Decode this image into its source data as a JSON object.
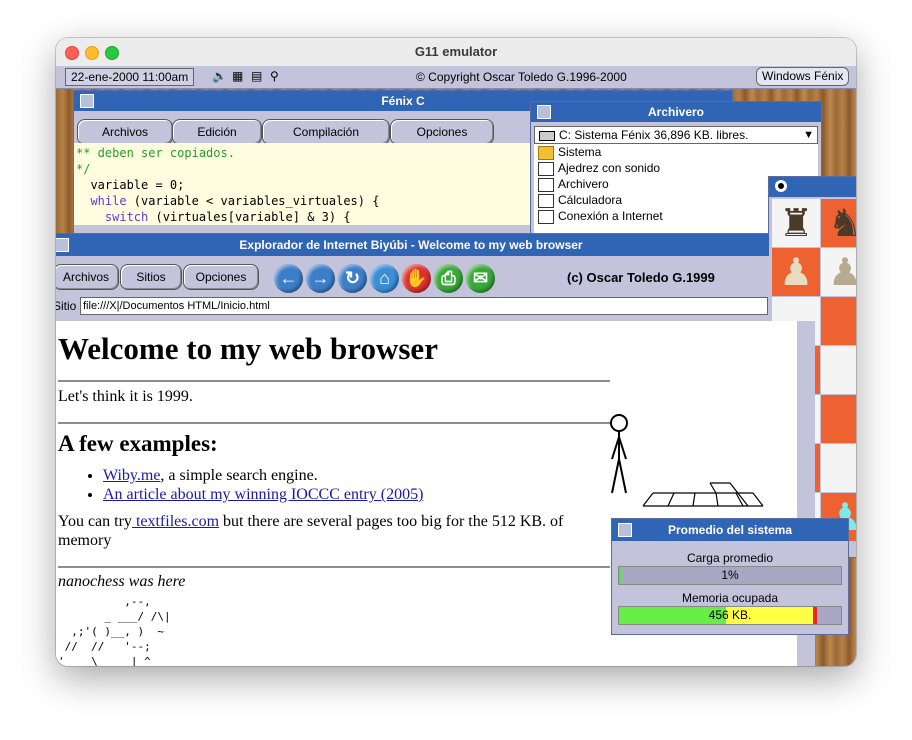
{
  "window": {
    "title": "G11 emulator"
  },
  "topbar": {
    "datetime": "22-ene-2000 11:00am",
    "copyright": "© Copyright Oscar Toledo G.1996-2000",
    "windows_button": "Windows Fénix",
    "icons": [
      "speaker-icon",
      "calculator-icon",
      "notepad-icon",
      "magnifier-icon"
    ]
  },
  "fenix": {
    "title": "Fénix C",
    "menu": [
      "Archivos",
      "Edición",
      "Compilación",
      "Opciones"
    ],
    "code": [
      {
        "a": "** deben ser copiados.",
        "b": "",
        "c": ""
      },
      {
        "a": "*/",
        "b": "",
        "c": ""
      },
      {
        "a": "  ",
        "b": "",
        "c": "variable = 0;"
      },
      {
        "a": "  ",
        "b": "while",
        "c": " (variable < variables_virtuales) {"
      },
      {
        "a": "    ",
        "b": "switch",
        "c": " (virtuales[variable] & 3) {"
      }
    ]
  },
  "archivero": {
    "title": "Archivero",
    "drive": "C: Sistema Fénix  36,896 KB. libres.",
    "items": [
      "Sistema",
      "Ajedrez con sonido",
      "Archivero",
      "Cálculadora",
      "Conexión a Internet"
    ]
  },
  "browser": {
    "title": "Explorador de Internet Biyúbi - Welcome to my web browser",
    "menu": [
      "Archivos",
      "Sitios",
      "Opciones"
    ],
    "credit": "(c) Oscar Toledo G.1999",
    "address_label": "Sitio",
    "address": "file:///X|/Documentos HTML/Inicio.html",
    "nav_icons": [
      "back-icon",
      "forward-icon",
      "reload-icon",
      "home-icon",
      "stop-icon",
      "print-icon",
      "mail-icon"
    ],
    "page": {
      "h1": "Welcome to my web browser",
      "intro": "Let's think it is 1999.",
      "h2": "A few examples:",
      "list": [
        {
          "link": "Wiby.me",
          "rest": ", a simple search engine."
        },
        {
          "link": "An article about my winning IOCCC entry (2005)",
          "rest": ""
        }
      ],
      "p_before": "You can try",
      "p_link": " textfiles.com",
      "p_after": " but there are several pages too big for the 512 KB. of memory",
      "italic": "nanochess was here",
      "ascii": "          ,--,\n       _ ___/ /\\|\n  ,;'( )__, )  ~\n //  //   '--;\n'    \\     | ^"
    }
  },
  "chess": {
    "pieces": {
      "black_rook": "♜",
      "black_knight": "♞",
      "black_pawn": "♟",
      "white_pawn": "♟"
    }
  },
  "promedio": {
    "title": "Promedio del sistema",
    "load_label": "Carga promedio",
    "load_value": "1%",
    "load_fraction": 0.01,
    "mem_label": "Memoria ocupada",
    "mem_value": "456 KB.",
    "mem_fraction": 0.89,
    "colors": {
      "load": "#55dd55",
      "mem_low": "#66ee44",
      "mem_high": "#ffff44",
      "mem_peak": "#ee2222"
    }
  }
}
